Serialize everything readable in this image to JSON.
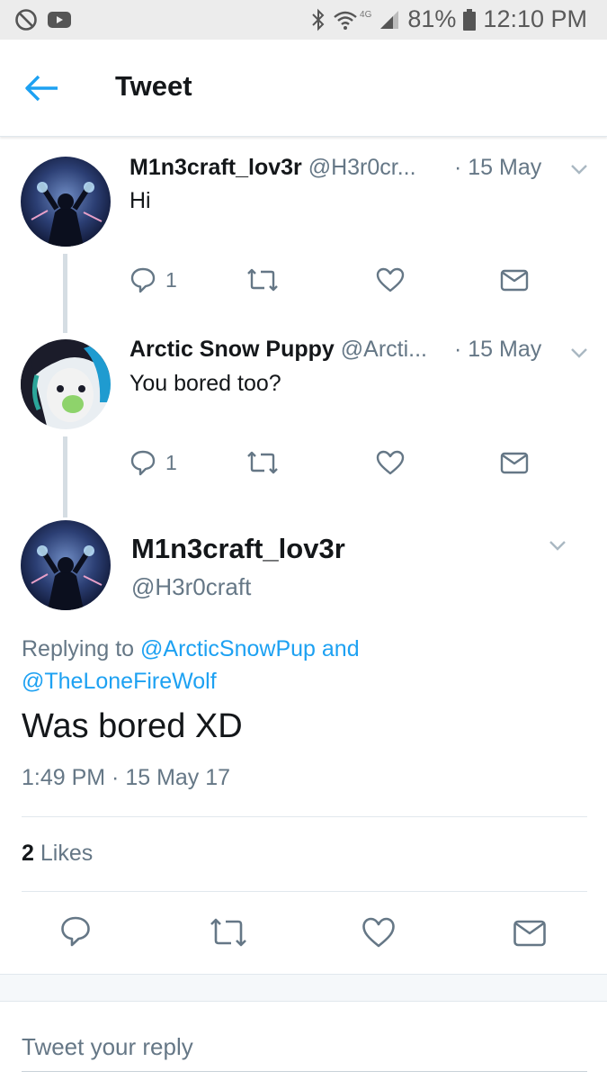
{
  "status_bar": {
    "network": "4G",
    "battery": "81%",
    "time": "12:10 PM"
  },
  "header": {
    "title": "Tweet"
  },
  "thread": [
    {
      "name": "M1n3craft_lov3r",
      "handle": "@H3r0cr...",
      "time": "· 15 May",
      "text": "Hi",
      "reply_count": "1"
    },
    {
      "name": "Arctic Snow Puppy",
      "handle": "@Arcti...",
      "time": "· 15 May",
      "text": "You bored too?",
      "reply_count": "1"
    }
  ],
  "main_tweet": {
    "name": "M1n3craft_lov3r",
    "handle": "@H3r0craft",
    "replying_prefix": "Replying to",
    "mention_1": "@ArcticSnowPup",
    "and": "and",
    "mention_2": "@TheLoneFireWolf",
    "text": "Was bored XD",
    "timestamp": "1:49 PM · 15 May 17",
    "likes_count": "2",
    "likes_label": "Likes"
  },
  "reply": {
    "placeholder": "Tweet your reply"
  },
  "colors": {
    "accent": "#1da1f2",
    "muted": "#657786",
    "text": "#14171a"
  }
}
